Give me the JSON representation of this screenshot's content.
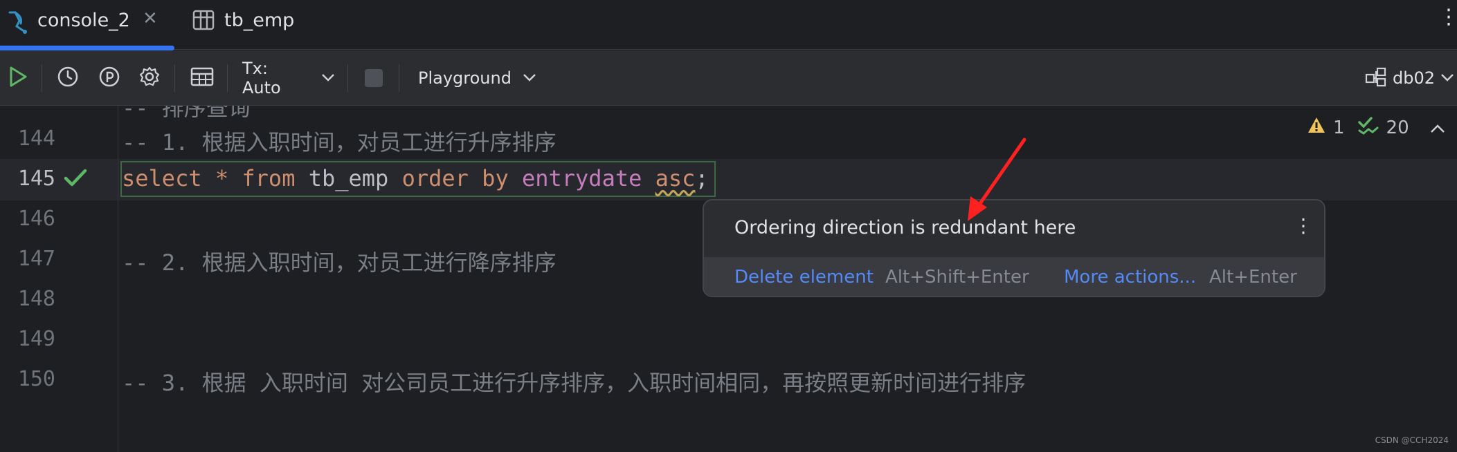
{
  "tabs": {
    "active": {
      "label": "console_2",
      "close": "✕"
    },
    "second": {
      "label": "tb_emp"
    },
    "more": "⋮"
  },
  "toolbar": {
    "tx_label": "Tx: Auto",
    "playground_label": "Playground",
    "datasource_label": "db02"
  },
  "editor": {
    "lines": [
      {
        "num": "144",
        "text": "-- 1. 根据入职时间，对员工进行升序排序"
      },
      {
        "num": "145"
      },
      {
        "num": "146"
      },
      {
        "num": "147",
        "text": "-- 2. 根据入职时间，对员工进行降序排序"
      },
      {
        "num": "148"
      },
      {
        "num": "149"
      },
      {
        "num": "150",
        "text": "-- 3. 根据 入职时间 对公司员工进行升序排序，入职时间相同，再按照更新时间进行排序"
      }
    ],
    "statement": {
      "kw_select": "select",
      "star": " * ",
      "kw_from": "from",
      "table": " tb_emp ",
      "kw_order": "order",
      "kw_by": " by ",
      "column": "entrydate",
      "space": " ",
      "kw_asc": "asc",
      "semicolon": ";"
    },
    "inspections": {
      "warnings": "1",
      "ok": "20"
    }
  },
  "popup": {
    "message": "Ordering direction is redundant here",
    "kebab": "⋮",
    "delete_action": "Delete element",
    "delete_shortcut": "Alt+Shift+Enter",
    "more_action": "More actions...",
    "more_shortcut": "Alt+Enter"
  },
  "watermark": "CSDN @CCH2024",
  "colors": {
    "accent": "#3574f0",
    "link": "#548af7",
    "keyword": "#cf8e6d",
    "identifier": "#c77dbb",
    "comment": "#7a7e85",
    "ok_green": "#5fb865",
    "warning": "#f2c55c",
    "arrow_red": "#ff2020"
  },
  "icons": [
    "database-console-icon",
    "close-icon",
    "table-icon",
    "more-vertical-icon",
    "run-icon",
    "history-icon",
    "parameters-icon",
    "settings-icon",
    "result-table-icon",
    "chevron-down-icon",
    "stop-icon",
    "datasource-icon",
    "check-icon",
    "warning-icon",
    "check-double-icon",
    "chevron-up-icon",
    "red-arrow-annotation"
  ]
}
